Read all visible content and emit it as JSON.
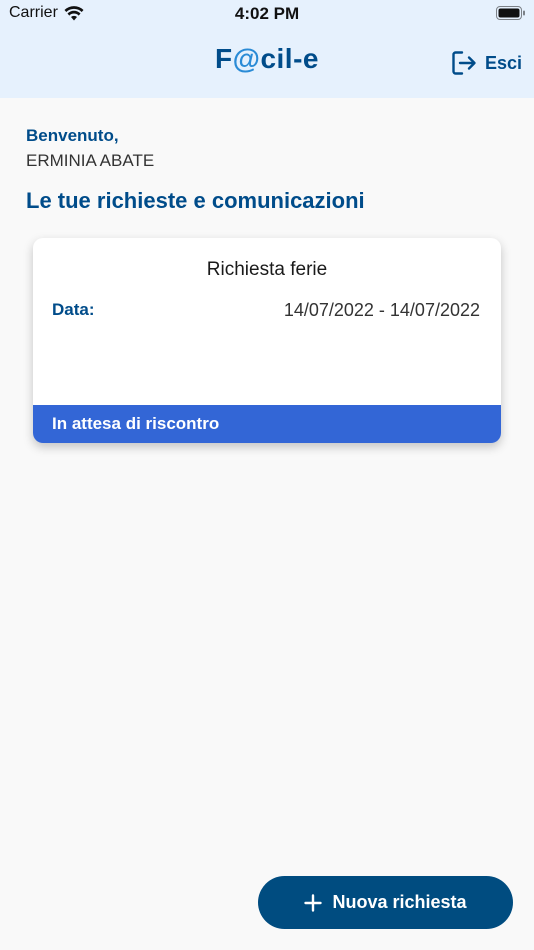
{
  "status_bar": {
    "carrier": "Carrier",
    "time": "4:02 PM"
  },
  "header": {
    "title_part1": "F",
    "title_accent": "@",
    "title_part2": "cil-e",
    "logout_label": "Esci",
    "logout_icon": "logout-icon"
  },
  "welcome": {
    "greeting": "Benvenuto,",
    "user_name": "ERMINIA ABATE"
  },
  "section": {
    "title": "Le tue richieste e comunicazioni"
  },
  "requests": [
    {
      "title": "Richiesta ferie",
      "date_label": "Data:",
      "date_value": "14/07/2022 - 14/07/2022",
      "status": "In attesa di riscontro"
    }
  ],
  "actions": {
    "new_request_label": "Nuova richiesta",
    "new_request_icon": "plus-icon"
  },
  "colors": {
    "header_bg": "#e6f1fd",
    "brand_blue": "#004c8a",
    "accent_blue": "#2a8bd6",
    "status_blue": "#3366d6",
    "button_bg": "#004c80",
    "page_bg": "#f9f9f9"
  }
}
